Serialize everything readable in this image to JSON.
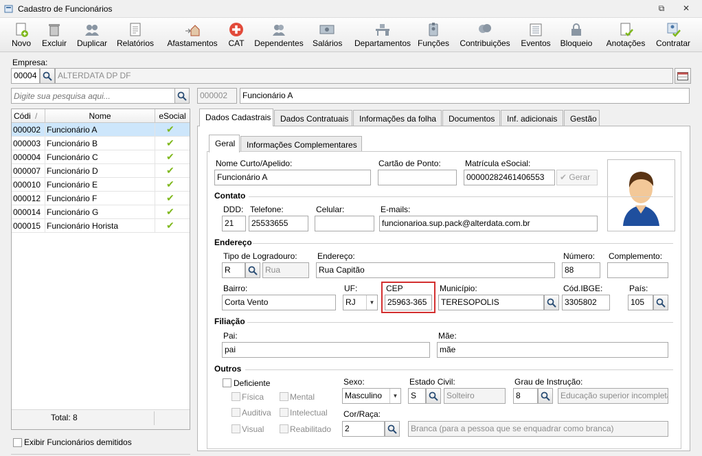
{
  "window": {
    "title": "Cadastro de Funcionários",
    "restore_glyph": "⧉",
    "close_glyph": "✕"
  },
  "toolbar": [
    {
      "label": "Novo",
      "icon": "new-doc-icon"
    },
    {
      "label": "Excluir",
      "icon": "trash-icon"
    },
    {
      "label": "Duplicar",
      "icon": "duplicate-people-icon"
    },
    {
      "label": "Relatórios",
      "icon": "report-icon"
    },
    {
      "label": "Afastamentos",
      "icon": "house-arrow-icon"
    },
    {
      "label": "CAT",
      "icon": "red-cross-icon"
    },
    {
      "label": "Dependentes",
      "icon": "people-icon"
    },
    {
      "label": "Salários",
      "icon": "money-icon"
    },
    {
      "label": "Departamentos",
      "icon": "desk-icon"
    },
    {
      "label": "Funções",
      "icon": "badge-icon"
    },
    {
      "label": "Contribuições",
      "icon": "heads-icon"
    },
    {
      "label": "Eventos",
      "icon": "list-icon"
    },
    {
      "label": "Bloqueio",
      "icon": "lock-icon"
    },
    {
      "label": "Anotações",
      "icon": "note-check-icon"
    },
    {
      "label": "Contratar",
      "icon": "hire-icon"
    }
  ],
  "empresa": {
    "label": "Empresa:",
    "code": "00004",
    "name": "ALTERDATA DP  DF"
  },
  "search": {
    "placeholder": "Digite sua pesquisa aqui..."
  },
  "selected": {
    "code": "000002",
    "name": "Funcionário A"
  },
  "grid": {
    "headers": {
      "code": "Códi",
      "sort": "/",
      "name": "Nome",
      "esocial": "eSocial"
    },
    "rows": [
      {
        "code": "000002",
        "name": "Funcionário A"
      },
      {
        "code": "000003",
        "name": "Funcionário B"
      },
      {
        "code": "000004",
        "name": "Funcionário C"
      },
      {
        "code": "000007",
        "name": "Funcionário D"
      },
      {
        "code": "000010",
        "name": "Funcionário E"
      },
      {
        "code": "000012",
        "name": "Funcionário F"
      },
      {
        "code": "000014",
        "name": "Funcionário G"
      },
      {
        "code": "000015",
        "name": "Funcionário Horista"
      }
    ],
    "check_glyph": "✔",
    "total": "Total: 8"
  },
  "show_dismissed": "Exibir Funcionários demitidos",
  "tabs": [
    "Dados Cadastrais",
    "Dados Contratuais",
    "Informações da folha",
    "Documentos",
    "Inf. adicionais",
    "Gestão"
  ],
  "subtabs": [
    "Geral",
    "Informações Complementares"
  ],
  "form": {
    "nome_curto": {
      "label": "Nome Curto/Apelido:",
      "value": "Funcionário A"
    },
    "cartao": {
      "label": "Cartão de Ponto:",
      "value": ""
    },
    "matricula": {
      "label": "Matrícula eSocial:",
      "value": "00000282461406553"
    },
    "gerar": "Gerar",
    "contato": "Contato",
    "ddd": {
      "label": "DDD:",
      "value": "21"
    },
    "telefone": {
      "label": "Telefone:",
      "value": "25533655"
    },
    "celular": {
      "label": "Celular:",
      "value": ""
    },
    "emails": {
      "label": "E-mails:",
      "value": "funcionarioa.sup.pack@alterdata.com.br"
    },
    "endereco_section": "Endereço",
    "tipo_log": {
      "label": "Tipo de Logradouro:",
      "code": "R",
      "desc": "Rua"
    },
    "endereco": {
      "label": "Endereço:",
      "value": "Rua Capitão"
    },
    "numero": {
      "label": "Número:",
      "value": "88"
    },
    "complemento": {
      "label": "Complemento:",
      "value": ""
    },
    "bairro": {
      "label": "Bairro:",
      "value": "Corta Vento"
    },
    "uf": {
      "label": "UF:",
      "value": "RJ"
    },
    "cep": {
      "label": "CEP",
      "value": "25963-365"
    },
    "municipio": {
      "label": "Município:",
      "value": "TERESOPOLIS"
    },
    "ibge": {
      "label": "Cód.IBGE:",
      "value": "3305802"
    },
    "pais": {
      "label": "País:",
      "value": "105"
    },
    "filiacao": "Filiação",
    "pai": {
      "label": "Pai:",
      "value": "pai"
    },
    "mae": {
      "label": "Mãe:",
      "value": "mãe"
    },
    "outros": "Outros",
    "deficiente": "Deficiente",
    "deficiencias": [
      "Física",
      "Mental",
      "Auditiva",
      "Intelectual",
      "Visual",
      "Reabilitado"
    ],
    "sexo": {
      "label": "Sexo:",
      "value": "Masculino"
    },
    "estado_civil": {
      "label": "Estado Civil:",
      "code": "S",
      "desc": "Solteiro"
    },
    "grau": {
      "label": "Grau de Instrução:",
      "code": "8",
      "desc": "Educação superior incompleta"
    },
    "cor": {
      "label": "Cor/Raça:",
      "code": "2",
      "desc": "Branca (para a pessoa que se enquadrar como branca)"
    }
  },
  "colors": {
    "highlight": "#d32f2f",
    "selection": "#cde6fb",
    "check": "#7fb81d"
  }
}
